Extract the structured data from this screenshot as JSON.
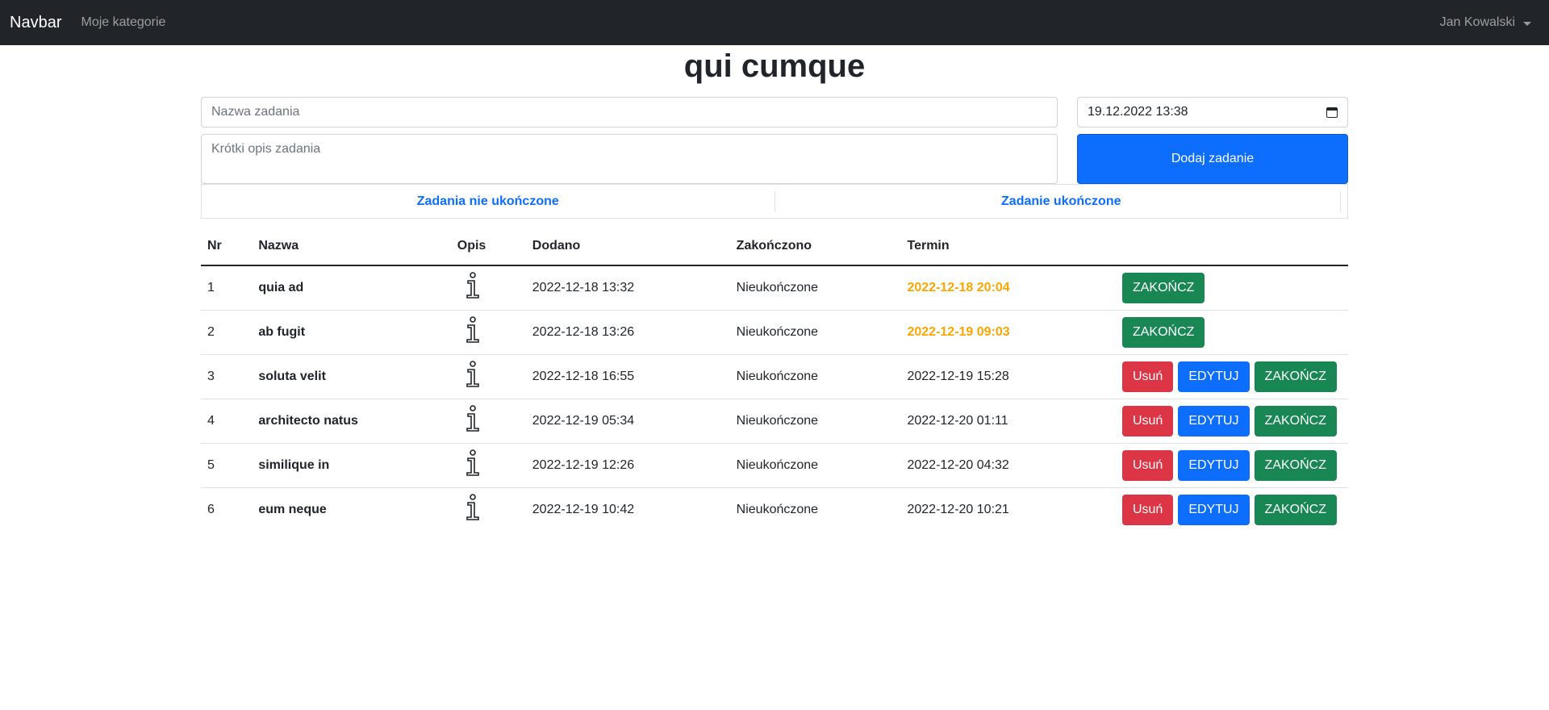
{
  "navbar": {
    "brand": "Navbar",
    "link_categories": "Moje kategorie",
    "user": "Jan Kowalski"
  },
  "page": {
    "title": "qui cumque"
  },
  "form": {
    "name_placeholder": "Nazwa zadania",
    "desc_placeholder": "Krótki opis zadania",
    "date_value": "19.12.2022 13:38",
    "add_button": "Dodaj zadanie"
  },
  "tabs": {
    "incomplete": "Zadania nie ukończone",
    "complete": "Zadanie ukończone"
  },
  "table": {
    "headers": {
      "nr": "Nr",
      "name": "Nazwa",
      "desc": "Opis",
      "added": "Dodano",
      "finished": "Zakończono",
      "deadline": "Termin"
    },
    "labels": {
      "delete": "Usuń",
      "edit": "EDYTUJ",
      "finish": "ZAKOŃCZ"
    },
    "rows": [
      {
        "nr": "1",
        "name": "quia ad",
        "added": "2022-12-18 13:32",
        "finished": "Nieukończone",
        "deadline": "2022-12-18 20:04",
        "deadline_warn": true,
        "editable": false
      },
      {
        "nr": "2",
        "name": "ab fugit",
        "added": "2022-12-18 13:26",
        "finished": "Nieukończone",
        "deadline": "2022-12-19 09:03",
        "deadline_warn": true,
        "editable": false
      },
      {
        "nr": "3",
        "name": "soluta velit",
        "added": "2022-12-18 16:55",
        "finished": "Nieukończone",
        "deadline": "2022-12-19 15:28",
        "deadline_warn": false,
        "editable": true
      },
      {
        "nr": "4",
        "name": "architecto natus",
        "added": "2022-12-19 05:34",
        "finished": "Nieukończone",
        "deadline": "2022-12-20 01:11",
        "deadline_warn": false,
        "editable": true
      },
      {
        "nr": "5",
        "name": "similique in",
        "added": "2022-12-19 12:26",
        "finished": "Nieukończone",
        "deadline": "2022-12-20 04:32",
        "deadline_warn": false,
        "editable": true
      },
      {
        "nr": "6",
        "name": "eum neque",
        "added": "2022-12-19 10:42",
        "finished": "Nieukończone",
        "deadline": "2022-12-20 10:21",
        "deadline_warn": false,
        "editable": true
      }
    ]
  },
  "colors": {
    "navbar_bg": "#212529",
    "primary": "#0d6efd",
    "danger": "#dc3545",
    "success": "#198754",
    "deadline_warning": "#ffa500"
  },
  "icons": {
    "description": "info-icon",
    "calendar": "calendar-icon",
    "dropdown": "chevron-down-icon"
  }
}
